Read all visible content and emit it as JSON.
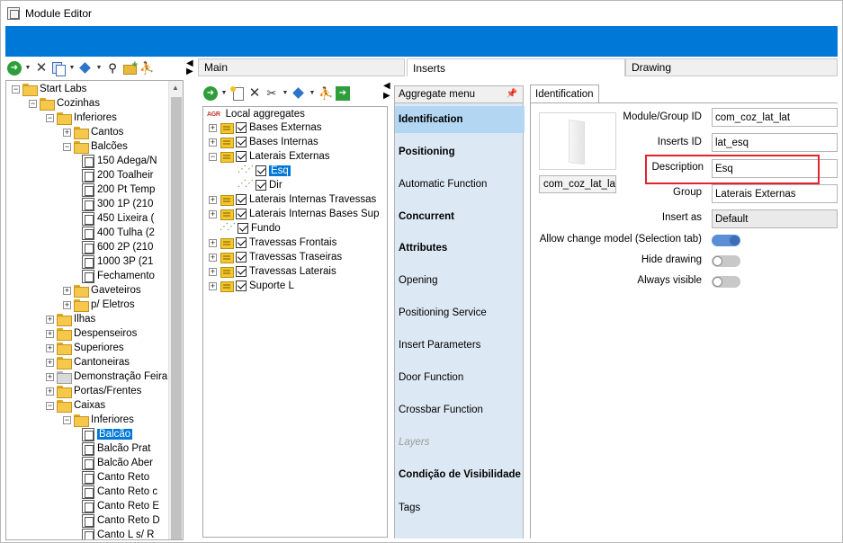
{
  "window": {
    "title": "Module Editor"
  },
  "tabs": {
    "main": "Main",
    "inserts": "Inserts",
    "drawing": "Drawing"
  },
  "left_tree": {
    "rows": [
      {
        "label": "Start Labs",
        "level": 0,
        "kind": "folder"
      },
      {
        "label": "Cozinhas",
        "level": 1,
        "kind": "folder"
      },
      {
        "label": "Inferiores",
        "level": 2,
        "kind": "folder"
      },
      {
        "label": "Cantos",
        "level": 3,
        "kind": "folder"
      },
      {
        "label": "Balcões",
        "level": 3,
        "kind": "folder"
      },
      {
        "label": "150 Adega/N",
        "level": 4,
        "kind": "doc"
      },
      {
        "label": "200 Toalheir",
        "level": 4,
        "kind": "doc"
      },
      {
        "label": "200 Pt Temp",
        "level": 4,
        "kind": "doc"
      },
      {
        "label": "300 1P (210",
        "level": 4,
        "kind": "doc"
      },
      {
        "label": "450 Lixeira (",
        "level": 4,
        "kind": "doc"
      },
      {
        "label": "400 Tulha (2",
        "level": 4,
        "kind": "doc"
      },
      {
        "label": "600 2P (210",
        "level": 4,
        "kind": "doc"
      },
      {
        "label": "1000 3P (21",
        "level": 4,
        "kind": "doc"
      },
      {
        "label": "Fechamento",
        "level": 4,
        "kind": "doc"
      },
      {
        "label": "Gaveteiros",
        "level": 3,
        "kind": "folder"
      },
      {
        "label": "p/ Eletros",
        "level": 3,
        "kind": "folder"
      },
      {
        "label": "Ilhas",
        "level": 2,
        "kind": "folder"
      },
      {
        "label": "Despenseiros",
        "level": 2,
        "kind": "folder"
      },
      {
        "label": "Superiores",
        "level": 2,
        "kind": "folder"
      },
      {
        "label": "Cantoneiras",
        "level": 2,
        "kind": "folder"
      },
      {
        "label": "Demonstração Feira",
        "level": 2,
        "kind": "folder-gray"
      },
      {
        "label": "Portas/Frentes",
        "level": 2,
        "kind": "folder"
      },
      {
        "label": "Caixas",
        "level": 2,
        "kind": "folder"
      },
      {
        "label": "Inferiores",
        "level": 3,
        "kind": "folder"
      },
      {
        "label": "Balcão",
        "level": 4,
        "kind": "doc",
        "selected": true
      },
      {
        "label": "Balcão Prat",
        "level": 4,
        "kind": "doc"
      },
      {
        "label": "Balcão Aber",
        "level": 4,
        "kind": "doc"
      },
      {
        "label": "Canto Reto",
        "level": 4,
        "kind": "doc"
      },
      {
        "label": "Canto Reto c",
        "level": 4,
        "kind": "doc"
      },
      {
        "label": "Canto Reto E",
        "level": 4,
        "kind": "doc"
      },
      {
        "label": "Canto Reto D",
        "level": 4,
        "kind": "doc"
      },
      {
        "label": "Canto L s/ R",
        "level": 4,
        "kind": "doc"
      }
    ]
  },
  "middle_tree": {
    "root_badge": "AGR",
    "root_label": "Local aggregates",
    "rows": [
      {
        "label": "Bases Externas",
        "indent": 0,
        "expander": "+",
        "icon": "agg",
        "checked": true
      },
      {
        "label": "Bases Internas",
        "indent": 0,
        "expander": "+",
        "icon": "agg",
        "checked": true
      },
      {
        "label": "Laterais Externas",
        "indent": 0,
        "expander": "-",
        "icon": "agg",
        "checked": true
      },
      {
        "label": "Esq",
        "indent": 1,
        "expander": "",
        "icon": "ins",
        "checked": true,
        "selected": true
      },
      {
        "label": "Dir",
        "indent": 1,
        "expander": "",
        "icon": "ins",
        "checked": true
      },
      {
        "label": "Laterais Internas Travessas",
        "indent": 0,
        "expander": "+",
        "icon": "agg",
        "checked": true
      },
      {
        "label": "Laterais Internas Bases Sup",
        "indent": 0,
        "expander": "+",
        "icon": "agg",
        "checked": true
      },
      {
        "label": "Fundo",
        "indent": 0,
        "expander": "",
        "icon": "ins",
        "checked": true
      },
      {
        "label": "Travessas Frontais",
        "indent": 0,
        "expander": "+",
        "icon": "agg",
        "checked": true
      },
      {
        "label": "Travessas Traseiras",
        "indent": 0,
        "expander": "+",
        "icon": "agg",
        "checked": true
      },
      {
        "label": "Travessas Laterais",
        "indent": 0,
        "expander": "+",
        "icon": "agg",
        "checked": true
      },
      {
        "label": "Suporte L",
        "indent": 0,
        "expander": "+",
        "icon": "agg",
        "checked": true
      }
    ]
  },
  "aggregate_menu": {
    "title": "Aggregate menu",
    "items": [
      {
        "label": "Identification",
        "style": "active"
      },
      {
        "label": "Positioning",
        "style": "bold"
      },
      {
        "label": "Automatic Function",
        "style": "normal"
      },
      {
        "label": "Concurrent",
        "style": "bold"
      },
      {
        "label": "Attributes",
        "style": "bold"
      },
      {
        "label": "Opening",
        "style": "normal"
      },
      {
        "label": "Positioning Service",
        "style": "normal"
      },
      {
        "label": "Insert Parameters",
        "style": "normal"
      },
      {
        "label": "Door Function",
        "style": "normal"
      },
      {
        "label": "Crossbar Function",
        "style": "normal"
      },
      {
        "label": "Layers",
        "style": "disabled"
      },
      {
        "label": "Condição de Visibilidade",
        "style": "bold"
      },
      {
        "label": "Tags",
        "style": "normal"
      }
    ]
  },
  "identification": {
    "tab_label": "Identification",
    "thumbnail_caption": "com_coz_lat_la",
    "fields": {
      "module_group_id": {
        "label": "Module/Group ID",
        "value": "com_coz_lat_lat"
      },
      "inserts_id": {
        "label": "Inserts ID",
        "value": "lat_esq"
      },
      "description": {
        "label": "Description",
        "value": "Esq"
      },
      "group": {
        "label": "Group",
        "value": "Laterais Externas"
      },
      "insert_as": {
        "label": "Insert as",
        "value": "Default"
      }
    },
    "toggles": {
      "allow_change_model": {
        "label": "Allow change model (Selection tab)",
        "on": true
      },
      "hide_drawing": {
        "label": "Hide drawing",
        "on": false
      },
      "always_visible": {
        "label": "Always visible",
        "on": false
      }
    }
  }
}
